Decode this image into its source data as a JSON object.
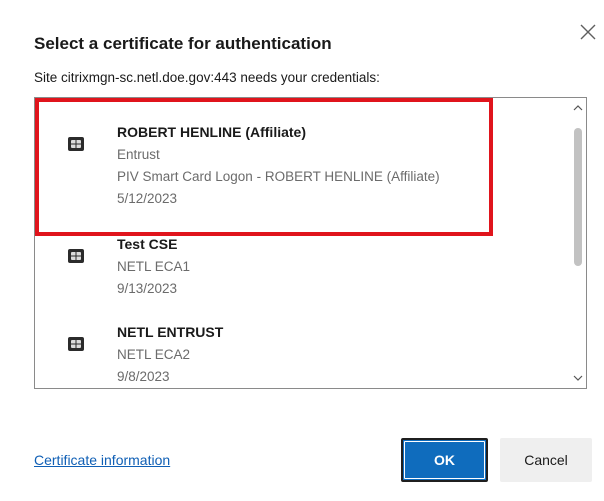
{
  "dialog": {
    "title": "Select a certificate for authentication",
    "subtitle": "Site citrixmgn-sc.netl.doe.gov:443 needs your credentials:"
  },
  "certificates": [
    {
      "name": "ROBERT HENLINE (Affiliate)",
      "issuer": "Entrust",
      "purpose": "PIV Smart Card Logon - ROBERT HENLINE (Affiliate)",
      "date": "5/12/2023",
      "highlighted": true
    },
    {
      "name": "Test CSE",
      "issuer": "NETL ECA1",
      "date": "9/13/2023"
    },
    {
      "name": "NETL ENTRUST",
      "issuer": "NETL ECA2",
      "date": "9/8/2023"
    }
  ],
  "footer": {
    "cert_info_link": "Certificate information",
    "ok_label": "OK",
    "cancel_label": "Cancel"
  },
  "colors": {
    "highlight": "#e0141c",
    "primary_button": "#0f6cbd",
    "link": "#0f5fb5"
  },
  "icons": {
    "close": "close-icon",
    "certificate": "smart-card-chip-icon",
    "scroll_up": "chevron-up-icon",
    "scroll_down": "chevron-down-icon"
  }
}
